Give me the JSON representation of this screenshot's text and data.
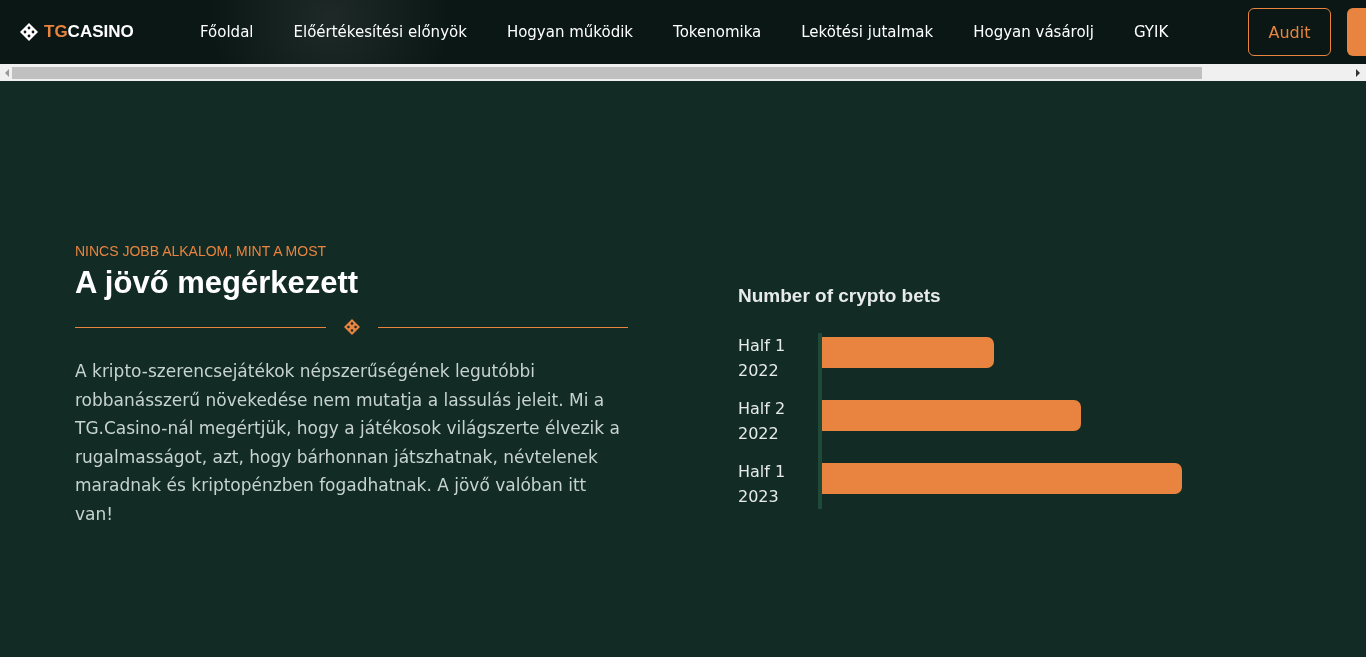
{
  "header": {
    "logo": {
      "accent": "TG",
      "rest": "CASINO"
    },
    "nav": [
      {
        "label": "Főoldal"
      },
      {
        "label": "Előértékesítési előnyök"
      },
      {
        "label": "Hogyan működik"
      },
      {
        "label": "Tokenomika"
      },
      {
        "label": "Lekötési jutalmak"
      },
      {
        "label": "Hogyan vásárolj"
      },
      {
        "label": "GYIK"
      }
    ],
    "audit_button": "Audit"
  },
  "section": {
    "eyebrow": "NINCS JOBB ALKALOM, MINT A MOST",
    "heading": "A jövő megérkezett",
    "paragraph": "A kripto-szerencsejátékok népszerűségének legutóbbi robbanásszerű növekedése nem mutatja a lassulás jeleit. Mi a TG.Casino-nál megértjük, hogy a játékosok világszerte élvezik a rugalmasságot, azt, hogy bárhonnan játszhatnak, névtelenek maradnak és kriptopénzben fogadhatnak. A jövő valóban itt van!"
  },
  "chart": {
    "title": "Number of crypto bets",
    "bars": [
      {
        "label_line1": "Half 1",
        "label_line2": "2022"
      },
      {
        "label_line1": "Half 2",
        "label_line2": "2022"
      },
      {
        "label_line1": "Half 1",
        "label_line2": "2023"
      }
    ]
  }
}
